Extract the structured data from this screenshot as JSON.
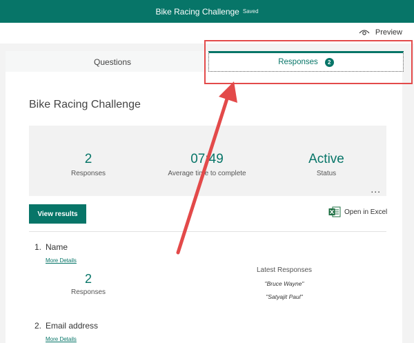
{
  "app": {
    "title": "Bike Racing Challenge",
    "status": "Saved"
  },
  "toolbar": {
    "preview_label": "Preview",
    "preview_icon": "eye-icon"
  },
  "tabs": [
    {
      "label": "Questions",
      "active": false
    },
    {
      "label": "Responses",
      "active": true,
      "badge": "2"
    }
  ],
  "form": {
    "title": "Bike Racing Challenge"
  },
  "summary": {
    "responses_value": "2",
    "responses_label": "Responses",
    "time_value": "07:49",
    "time_label": "Average time to complete",
    "status_value": "Active",
    "status_label": "Status",
    "more": "..."
  },
  "actions": {
    "view_results": "View results",
    "open_excel": "Open in Excel",
    "excel_icon": "excel-icon"
  },
  "questions": [
    {
      "number": "1.",
      "title": "Name",
      "more_details": "More Details",
      "count_value": "2",
      "count_label": "Responses",
      "latest_header": "Latest Responses",
      "latest": [
        "\"Bruce Wayne\"",
        "\"Satyajit Paul\""
      ]
    },
    {
      "number": "2.",
      "title": "Email address",
      "more_details": "More Details"
    }
  ],
  "colors": {
    "brand": "#077568",
    "annotation": "#e34a4a"
  }
}
